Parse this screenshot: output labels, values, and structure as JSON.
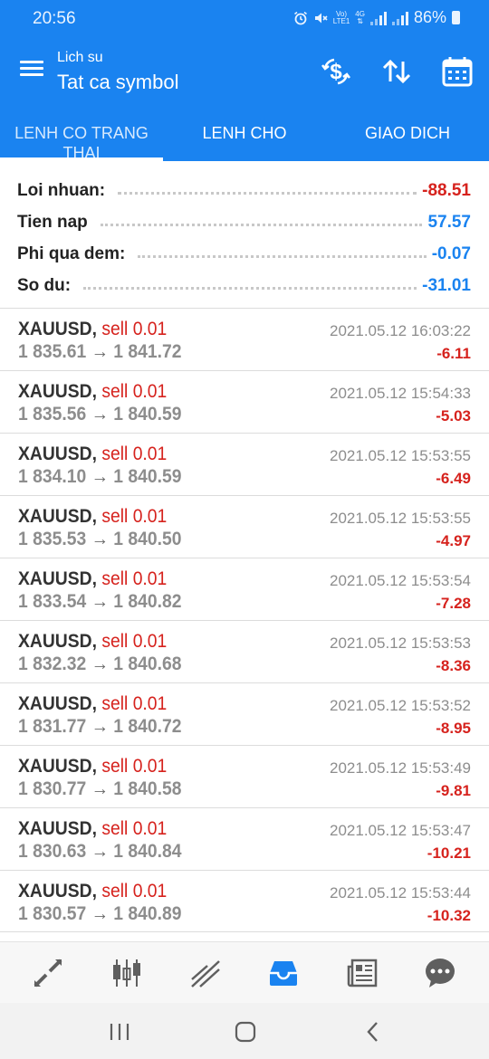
{
  "status_bar": {
    "time": "20:56",
    "network_label_1": "Vo)",
    "network_label_2": "LTE1",
    "network_label_3": "4G",
    "battery": "86%"
  },
  "header": {
    "subtitle": "Lich su",
    "title": "Tat ca symbol",
    "actions": [
      "dollar-refresh-icon",
      "sort-arrows-icon",
      "calendar-icon"
    ]
  },
  "tabs": [
    {
      "label": "LENH CO TRANG THAI",
      "active": true
    },
    {
      "label": "LENH CHO",
      "active": false
    },
    {
      "label": "GIAO DICH",
      "active": false
    }
  ],
  "summary": [
    {
      "label": "Loi nhuan:",
      "value": "-88.51",
      "color": "#d6221d"
    },
    {
      "label": "Tien nap",
      "value": "57.57",
      "color": "#1a83f0"
    },
    {
      "label": "Phi qua dem:",
      "value": "-0.07",
      "color": "#1a83f0"
    },
    {
      "label": "So du:",
      "value": "-31.01",
      "color": "#1a83f0"
    }
  ],
  "deals": [
    {
      "symbol": "XAUUSD,",
      "side": "sell 0.01",
      "open": "1 835.61",
      "arrow": "→",
      "close": "1 841.72",
      "time": "2021.05.12 16:03:22",
      "profit": "-6.11"
    },
    {
      "symbol": "XAUUSD,",
      "side": "sell 0.01",
      "open": "1 835.56",
      "arrow": "→",
      "close": "1 840.59",
      "time": "2021.05.12 15:54:33",
      "profit": "-5.03"
    },
    {
      "symbol": "XAUUSD,",
      "side": "sell 0.01",
      "open": "1 834.10",
      "arrow": "→",
      "close": "1 840.59",
      "time": "2021.05.12 15:53:55",
      "profit": "-6.49"
    },
    {
      "symbol": "XAUUSD,",
      "side": "sell 0.01",
      "open": "1 835.53",
      "arrow": "→",
      "close": "1 840.50",
      "time": "2021.05.12 15:53:55",
      "profit": "-4.97"
    },
    {
      "symbol": "XAUUSD,",
      "side": "sell 0.01",
      "open": "1 833.54",
      "arrow": "→",
      "close": "1 840.82",
      "time": "2021.05.12 15:53:54",
      "profit": "-7.28"
    },
    {
      "symbol": "XAUUSD,",
      "side": "sell 0.01",
      "open": "1 832.32",
      "arrow": "→",
      "close": "1 840.68",
      "time": "2021.05.12 15:53:53",
      "profit": "-8.36"
    },
    {
      "symbol": "XAUUSD,",
      "side": "sell 0.01",
      "open": "1 831.77",
      "arrow": "→",
      "close": "1 840.72",
      "time": "2021.05.12 15:53:52",
      "profit": "-8.95"
    },
    {
      "symbol": "XAUUSD,",
      "side": "sell 0.01",
      "open": "1 830.77",
      "arrow": "→",
      "close": "1 840.58",
      "time": "2021.05.12 15:53:49",
      "profit": "-9.81"
    },
    {
      "symbol": "XAUUSD,",
      "side": "sell 0.01",
      "open": "1 830.63",
      "arrow": "→",
      "close": "1 840.84",
      "time": "2021.05.12 15:53:47",
      "profit": "-10.21"
    },
    {
      "symbol": "XAUUSD,",
      "side": "sell 0.01",
      "open": "1 830.57",
      "arrow": "→",
      "close": "1 840.89",
      "time": "2021.05.12 15:53:44",
      "profit": "-10.32"
    }
  ],
  "bottom_nav": [
    {
      "icon": "quotes-icon",
      "active": false
    },
    {
      "icon": "chart-candles-icon",
      "active": false
    },
    {
      "icon": "trade-icon",
      "active": false
    },
    {
      "icon": "history-inbox-icon",
      "active": true
    },
    {
      "icon": "news-icon",
      "active": false
    },
    {
      "icon": "chat-icon",
      "active": false
    }
  ],
  "colors": {
    "brand_blue": "#1a83f0",
    "loss_red": "#d6221d",
    "muted_gray": "#8d8d8d"
  }
}
